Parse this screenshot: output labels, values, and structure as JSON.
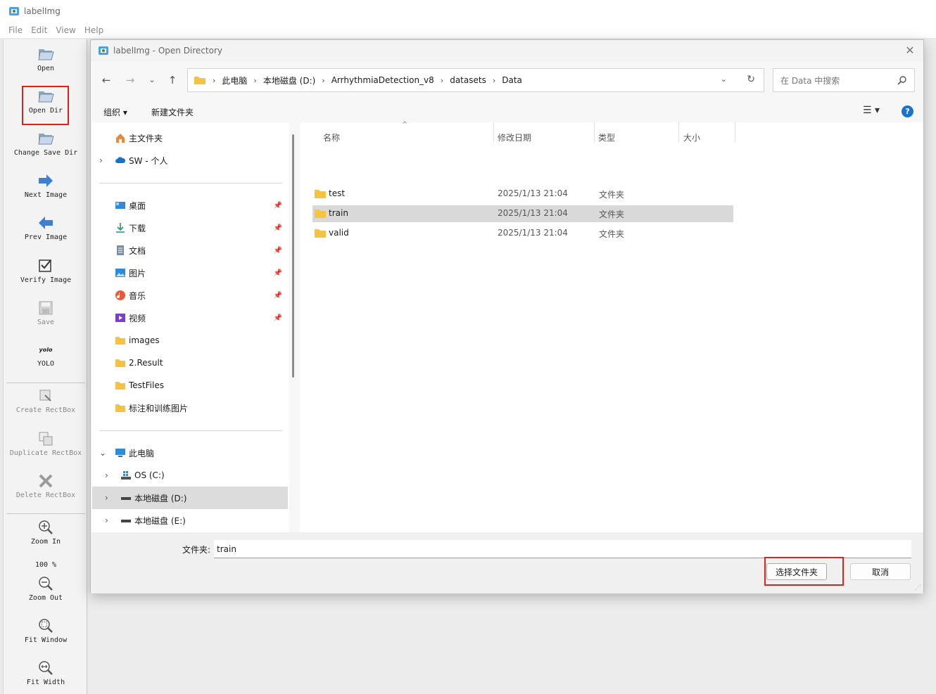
{
  "app": {
    "title": "labelImg",
    "menu": [
      "File",
      "Edit",
      "View",
      "Help"
    ]
  },
  "toolbar": {
    "open": "Open",
    "open_dir": "Open Dir",
    "change_save_dir": "Change Save Dir",
    "next_image": "Next Image",
    "prev_image": "Prev Image",
    "verify_image": "Verify Image",
    "save": "Save",
    "format_icon_text": "yolo",
    "format": "YOLO",
    "create_rectbox": "Create RectBox",
    "duplicate_rectbox": "Duplicate RectBox",
    "delete_rectbox": "Delete RectBox",
    "zoom_in": "Zoom In",
    "zoom_level": "100 %",
    "zoom_out": "Zoom Out",
    "fit_window": "Fit Window",
    "fit_width": "Fit Width"
  },
  "dialog": {
    "title": "labelImg - Open Directory",
    "breadcrumb": [
      "此电脑",
      "本地磁盘 (D:)",
      "ArrhythmiaDetection_v8",
      "datasets",
      "Data"
    ],
    "search_placeholder": "在 Data 中搜索",
    "commands": {
      "organize": "组织 ▾",
      "new_folder": "新建文件夹"
    },
    "nav": {
      "home": "主文件夹",
      "onedrive": "SW - 个人",
      "desktop": "桌面",
      "downloads": "下载",
      "documents": "文档",
      "pictures": "图片",
      "music": "音乐",
      "videos": "视频",
      "images": "images",
      "result": "2.Result",
      "testfiles": "TestFiles",
      "label_train": "标注和训练图片",
      "this_pc": "此电脑",
      "drive_c": "OS (C:)",
      "drive_d": "本地磁盘 (D:)",
      "drive_e": "本地磁盘 (E:)"
    },
    "columns": {
      "name": "名称",
      "modified": "修改日期",
      "type": "类型",
      "size": "大小"
    },
    "files": [
      {
        "name": "test",
        "modified": "2025/1/13 21:04",
        "type": "文件夹"
      },
      {
        "name": "train",
        "modified": "2025/1/13 21:04",
        "type": "文件夹"
      },
      {
        "name": "valid",
        "modified": "2025/1/13 21:04",
        "type": "文件夹"
      }
    ],
    "folder_label": "文件夹:",
    "folder_value": "train",
    "select_button": "选择文件夹",
    "cancel_button": "取消"
  },
  "colors": {
    "highlight": "#e0221a",
    "folder": "#f5c242",
    "selection": "#d9d9d9"
  }
}
